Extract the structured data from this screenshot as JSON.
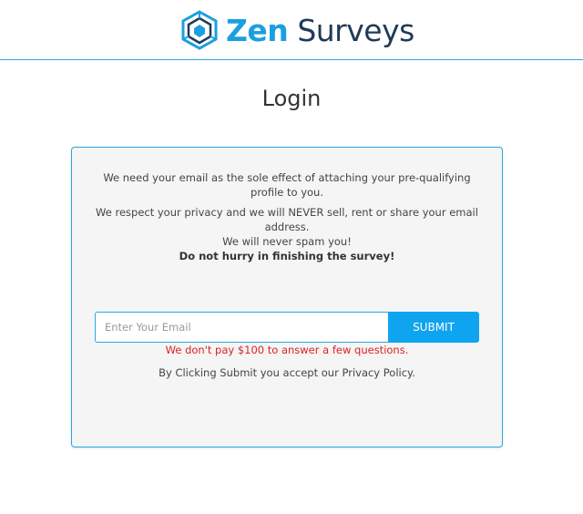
{
  "header": {
    "logo_icon": "zen-surveys-cube-icon",
    "brand_part1": "Zen",
    "brand_part2": "Surveys",
    "brand_color": "#1c9fe0",
    "brand_dark_color": "#1f3b57"
  },
  "page": {
    "title": "Login"
  },
  "card": {
    "intro_line1": "We need your email as the sole effect of attaching your pre-qualifying profile to you.",
    "intro_line2": "We respect your privacy and we will NEVER sell, rent or share your email address.",
    "intro_line3": "We will never spam you!",
    "intro_line4": "Do not hurry in finishing the survey!",
    "email_placeholder": "Enter Your Email",
    "email_value": "",
    "submit_label": "SUBMIT",
    "warning_text": "We don't pay $100 to answer a few questions.",
    "consent_text": "By Clicking Submit you accept our Privacy Policy.",
    "accent_color": "#0fa4ef",
    "warning_color": "#e02020"
  }
}
